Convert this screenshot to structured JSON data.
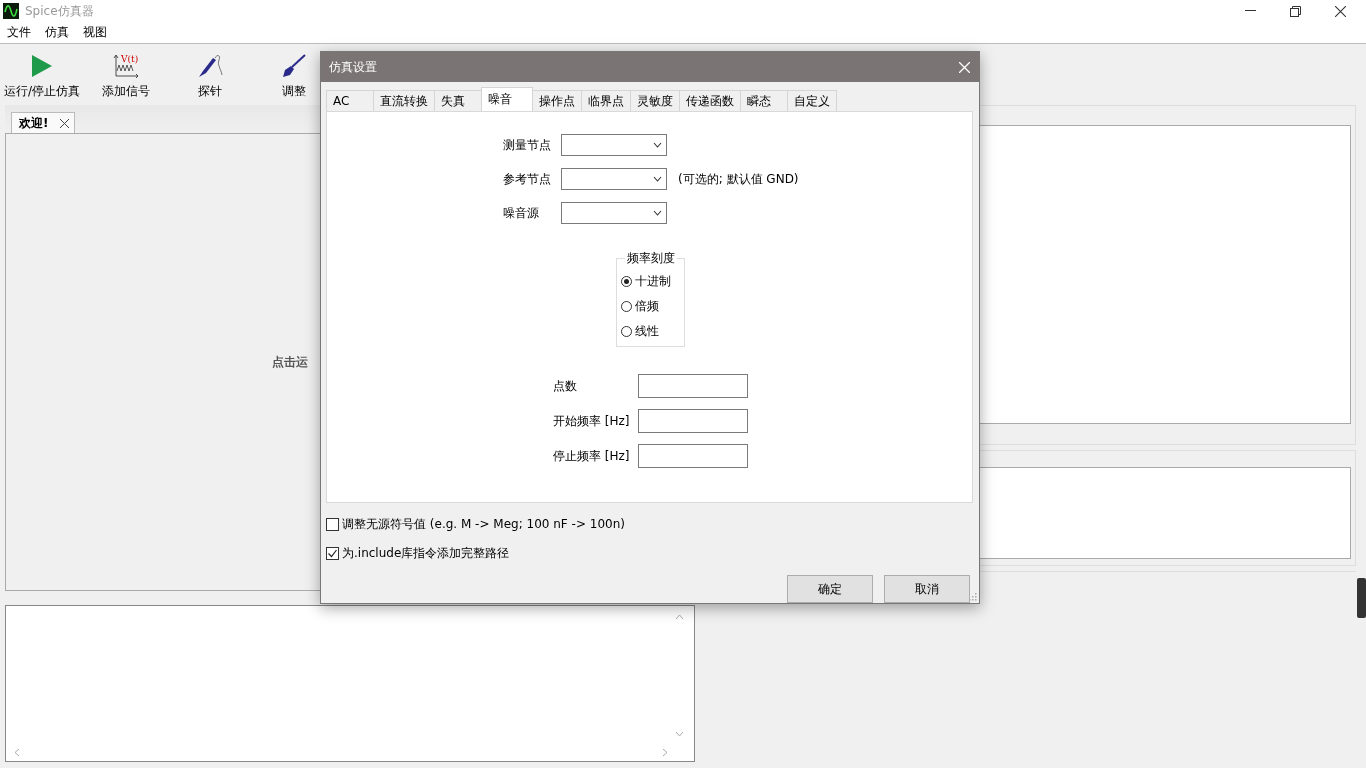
{
  "window": {
    "title": "Spice仿真器"
  },
  "menu": [
    "文件",
    "仿真",
    "视图"
  ],
  "toolbar": [
    {
      "label": "运行/停止仿真",
      "kind": "play"
    },
    {
      "label": "添加信号",
      "kind": "signal",
      "icon_text": "V(t)"
    },
    {
      "label": "探针",
      "kind": "probe"
    },
    {
      "label": "调整",
      "kind": "tune"
    }
  ],
  "doc_tabs": [
    {
      "label": "欢迎!",
      "selected": true
    }
  ],
  "welcome_text": "点击运",
  "dialog": {
    "title": "仿真设置",
    "tabs": [
      {
        "label": "AC",
        "selected": false
      },
      {
        "label": "直流转换",
        "selected": false
      },
      {
        "label": "失真",
        "selected": false
      },
      {
        "label": "噪音",
        "selected": true
      },
      {
        "label": "操作点",
        "selected": false
      },
      {
        "label": "临界点",
        "selected": false
      },
      {
        "label": "灵敏度",
        "selected": false
      },
      {
        "label": "传递函数",
        "selected": false
      },
      {
        "label": "瞬态",
        "selected": false
      },
      {
        "label": "自定义",
        "selected": false
      }
    ],
    "selects": [
      {
        "label": "测量节点"
      },
      {
        "label": "参考节点",
        "note": "(可选的; 默认值 GND)"
      },
      {
        "label": "噪音源"
      }
    ],
    "scale_group": {
      "title": "频率刻度",
      "options": [
        {
          "label": "十进制",
          "selected": true
        },
        {
          "label": "倍频",
          "selected": false
        },
        {
          "label": "线性",
          "selected": false
        }
      ]
    },
    "number_fields": [
      {
        "label": "点数"
      },
      {
        "label": "开始频率 [Hz]"
      },
      {
        "label": "停止频率 [Hz]"
      }
    ],
    "checkboxes": [
      {
        "label": "调整无源符号值 (e.g. M -> Meg; 100 nF -> 100n)",
        "checked": false
      },
      {
        "label": "为.include库指令添加完整路径",
        "checked": true
      }
    ],
    "buttons": [
      "确定",
      "取消"
    ]
  }
}
